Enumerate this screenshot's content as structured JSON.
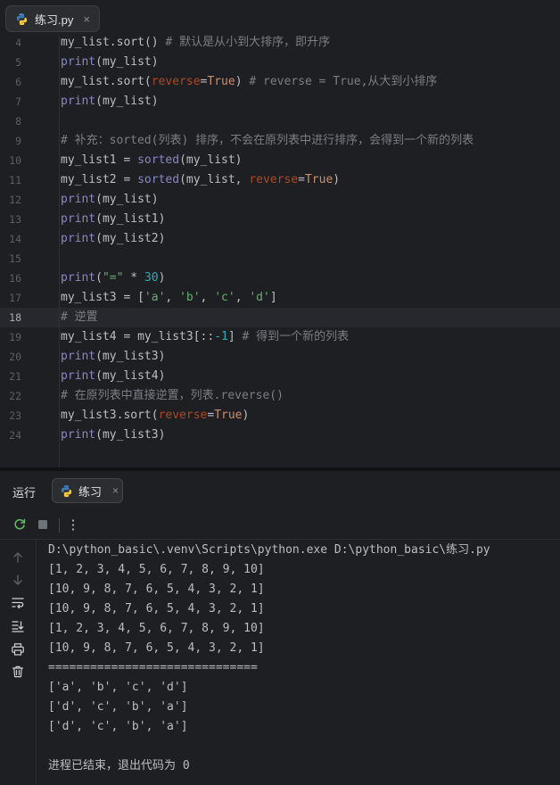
{
  "editor_tab": {
    "label": "练习.py",
    "close": "×"
  },
  "gutter": [
    "4",
    "5",
    "6",
    "7",
    "8",
    "9",
    "10",
    "11",
    "12",
    "13",
    "14",
    "15",
    "16",
    "17",
    "18",
    "19",
    "20",
    "21",
    "22",
    "23",
    "24"
  ],
  "code_lines": [
    [
      {
        "t": "my_list.",
        "c": "txt"
      },
      {
        "t": "sort",
        "c": "txt"
      },
      {
        "t": "() ",
        "c": "txt"
      },
      {
        "t": "# 默认是从小到大排序，即升序",
        "c": "cm"
      }
    ],
    [
      {
        "t": "print",
        "c": "b"
      },
      {
        "t": "(my_list)",
        "c": "txt"
      }
    ],
    [
      {
        "t": "my_list.sort(",
        "c": "txt"
      },
      {
        "t": "reverse",
        "c": "param"
      },
      {
        "t": "=",
        "c": "txt"
      },
      {
        "t": "True",
        "c": "kw"
      },
      {
        "t": ") ",
        "c": "txt"
      },
      {
        "t": "# reverse = True,从大到小排序",
        "c": "cm"
      }
    ],
    [
      {
        "t": "print",
        "c": "b"
      },
      {
        "t": "(my_list)",
        "c": "txt"
      }
    ],
    [],
    [
      {
        "t": "# 补充：sorted(列表) 排序，不会在原列表中进行排序，会得到一个新的列表",
        "c": "cm"
      }
    ],
    [
      {
        "t": "my_list1 = ",
        "c": "txt"
      },
      {
        "t": "sorted",
        "c": "b"
      },
      {
        "t": "(my_list)",
        "c": "txt"
      }
    ],
    [
      {
        "t": "my_list2 = ",
        "c": "txt"
      },
      {
        "t": "sorted",
        "c": "b"
      },
      {
        "t": "(my_list, ",
        "c": "txt"
      },
      {
        "t": "reverse",
        "c": "param"
      },
      {
        "t": "=",
        "c": "txt"
      },
      {
        "t": "True",
        "c": "kw"
      },
      {
        "t": ")",
        "c": "txt"
      }
    ],
    [
      {
        "t": "print",
        "c": "b"
      },
      {
        "t": "(my_list)",
        "c": "txt"
      }
    ],
    [
      {
        "t": "print",
        "c": "b"
      },
      {
        "t": "(my_list1)",
        "c": "txt"
      }
    ],
    [
      {
        "t": "print",
        "c": "b"
      },
      {
        "t": "(my_list2)",
        "c": "txt"
      }
    ],
    [],
    [
      {
        "t": "print",
        "c": "b"
      },
      {
        "t": "(",
        "c": "txt"
      },
      {
        "t": "\"=\"",
        "c": "str"
      },
      {
        "t": " * ",
        "c": "txt"
      },
      {
        "t": "30",
        "c": "num"
      },
      {
        "t": ")",
        "c": "txt"
      }
    ],
    [
      {
        "t": "my_list3 = [",
        "c": "txt"
      },
      {
        "t": "'a'",
        "c": "str"
      },
      {
        "t": ", ",
        "c": "txt"
      },
      {
        "t": "'b'",
        "c": "str"
      },
      {
        "t": ", ",
        "c": "txt"
      },
      {
        "t": "'c'",
        "c": "str"
      },
      {
        "t": ", ",
        "c": "txt"
      },
      {
        "t": "'d'",
        "c": "str"
      },
      {
        "t": "]",
        "c": "txt"
      }
    ],
    [
      {
        "t": "# 逆置",
        "c": "cm"
      }
    ],
    [
      {
        "t": "my_list4 = my_list3[::",
        "c": "txt"
      },
      {
        "t": "-1",
        "c": "num"
      },
      {
        "t": "] ",
        "c": "txt"
      },
      {
        "t": "# 得到一个新的列表",
        "c": "cm"
      }
    ],
    [
      {
        "t": "print",
        "c": "b"
      },
      {
        "t": "(my_list3)",
        "c": "txt"
      }
    ],
    [
      {
        "t": "print",
        "c": "b"
      },
      {
        "t": "(my_list4)",
        "c": "txt"
      }
    ],
    [
      {
        "t": "# 在原列表中直接逆置，列表.reverse()",
        "c": "cm"
      }
    ],
    [
      {
        "t": "my_list3.sort(",
        "c": "txt"
      },
      {
        "t": "reverse",
        "c": "param"
      },
      {
        "t": "=",
        "c": "txt"
      },
      {
        "t": "True",
        "c": "kw"
      },
      {
        "t": ")",
        "c": "txt"
      }
    ],
    [
      {
        "t": "print",
        "c": "b"
      },
      {
        "t": "(my_list3)",
        "c": "txt"
      }
    ]
  ],
  "current_line": "18",
  "run_panel": {
    "title": "运行",
    "tab_label": "练习",
    "tab_close": "×",
    "more": "⋮"
  },
  "console": [
    "D:\\python_basic\\.venv\\Scripts\\python.exe D:\\python_basic\\练习.py",
    "[1, 2, 3, 4, 5, 6, 7, 8, 9, 10]",
    "[10, 9, 8, 7, 6, 5, 4, 3, 2, 1]",
    "[10, 9, 8, 7, 6, 5, 4, 3, 2, 1]",
    "[1, 2, 3, 4, 5, 6, 7, 8, 9, 10]",
    "[10, 9, 8, 7, 6, 5, 4, 3, 2, 1]",
    "==============================",
    "['a', 'b', 'c', 'd']",
    "['d', 'c', 'b', 'a']",
    "['d', 'c', 'b', 'a']",
    "",
    "进程已结束，退出代码为 0"
  ],
  "icons": {
    "python": "python-logo-icon",
    "rerun": "rerun-icon",
    "stop": "stop-icon",
    "up": "arrow-up-icon",
    "down": "arrow-down-icon",
    "wrap": "soft-wrap-icon",
    "scroll_end": "scroll-to-end-icon",
    "print": "print-icon",
    "trash": "trash-icon"
  }
}
